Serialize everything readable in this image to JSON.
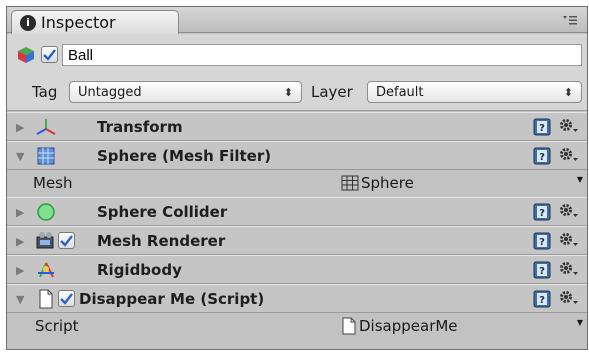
{
  "window": {
    "tab_title": "Inspector",
    "tab_icon": "info-icon",
    "menu_icon": "panel-menu-icon"
  },
  "object": {
    "name": "Ball",
    "active": true,
    "tag_label": "Tag",
    "tag_value": "Untagged",
    "layer_label": "Layer",
    "layer_value": "Default"
  },
  "components": [
    {
      "title": "Transform",
      "icon": "transform-icon",
      "expanded": false,
      "has_checkbox": false
    },
    {
      "title": "Sphere (Mesh Filter)",
      "icon": "mesh-filter-icon",
      "expanded": true,
      "has_checkbox": false,
      "property": {
        "label": "Mesh",
        "value": "Sphere",
        "value_icon": "mesh-grid-icon"
      }
    },
    {
      "title": "Sphere Collider",
      "icon": "sphere-collider-icon",
      "expanded": false,
      "has_checkbox": false
    },
    {
      "title": "Mesh Renderer",
      "icon": "mesh-renderer-icon",
      "expanded": false,
      "has_checkbox": true,
      "checked": true
    },
    {
      "title": "Rigidbody",
      "icon": "rigidbody-icon",
      "expanded": false,
      "has_checkbox": false
    },
    {
      "title": "Disappear Me (Script)",
      "icon": "script-file-icon",
      "expanded": true,
      "has_checkbox": true,
      "checked": true,
      "property": {
        "label": "Script",
        "value": "DisappearMe",
        "value_icon": "script-file-icon"
      }
    }
  ],
  "colors": {
    "panel_bg": "#c2c2c2",
    "header_bg": "#d6d6d6",
    "check_blue": "#2a64c8",
    "help_blue": "#3b6fb0"
  }
}
